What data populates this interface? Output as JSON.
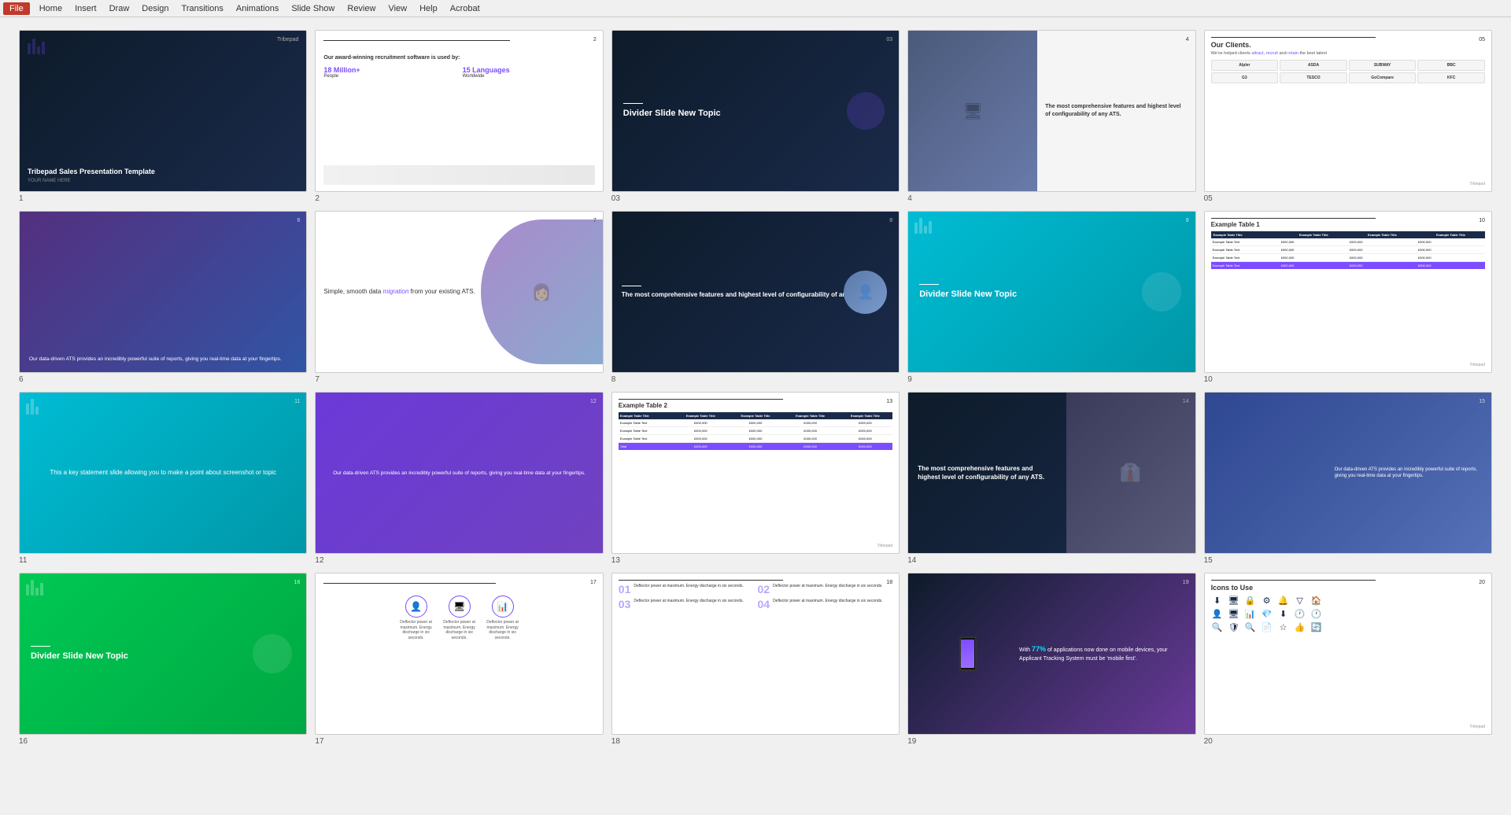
{
  "app": {
    "title": "Tribepad Sales Presentation Template",
    "menu_items": [
      "File",
      "Home",
      "Insert",
      "Draw",
      "Design",
      "Transitions",
      "Animations",
      "Slide Show",
      "Review",
      "View",
      "Help",
      "Acrobat"
    ]
  },
  "slides": [
    {
      "number": "1",
      "type": "title",
      "title": "Tribepad Sales Presentation Template",
      "subtitle": "YOUR NAME HERE",
      "logo": "Tribepad"
    },
    {
      "number": "2",
      "type": "stats",
      "heading": "Our award-winning recruitment software is used by:",
      "stat1_num": "18 Million+",
      "stat1_label": "People",
      "stat2_num": "15 Languages",
      "stat2_label": "Worldwide"
    },
    {
      "number": "03",
      "type": "divider",
      "title": "Divider Slide New Topic"
    },
    {
      "number": "4",
      "type": "photo-text",
      "text": "The most comprehensive features and highest level of configurability of any ATS."
    },
    {
      "number": "05",
      "type": "clients",
      "heading": "Our Clients.",
      "tagline": "We've helped clients attract, recruit and retain the best talent",
      "logos": [
        "Alpler",
        "ASDA",
        "SUBWAY",
        "BBC",
        "G3",
        "TESCO",
        "GoCompare",
        "KFC"
      ]
    },
    {
      "number": "6",
      "type": "photo-overlay",
      "text": "Our data-driven ATS provides an incredibly powerful suite of reports, giving you real-time data at your fingertips."
    },
    {
      "number": "7",
      "type": "migration",
      "text_left": "Simple, smooth data migration from your existing ATS."
    },
    {
      "number": "8",
      "type": "dark-text",
      "text": "The most comprehensive features and highest level of configurability of any ATS."
    },
    {
      "number": "9",
      "type": "divider-cyan",
      "title": "Divider Slide New Topic"
    },
    {
      "number": "10",
      "type": "table",
      "heading": "Example Table 1"
    },
    {
      "number": "11",
      "type": "statement-cyan",
      "text": "This a key statement slide allowing you to make a point about screenshot or topic"
    },
    {
      "number": "12",
      "type": "photo-purple",
      "text": "Our data-driven ATS provides an incredibly powerful suite of reports, giving you real-time data at your fingertips."
    },
    {
      "number": "13",
      "type": "table2",
      "heading": "Example Table 2"
    },
    {
      "number": "14",
      "type": "dark-photo",
      "text": "The most comprehensive features and highest level of configurability of any ATS."
    },
    {
      "number": "15",
      "type": "photo-blue",
      "text": "Our data-driven ATS provides an incredibly powerful suite of reports, giving you real-time data at your fingertips."
    },
    {
      "number": "16",
      "type": "divider-green",
      "title": "Divider Slide New Topic"
    },
    {
      "number": "17",
      "type": "icons",
      "icons": [
        {
          "symbol": "👤",
          "label": "Deflector power at maximum. Energy discharge in six seconds."
        },
        {
          "symbol": "🖥",
          "label": "Deflector power at maximum. Energy discharge in six seconds."
        },
        {
          "symbol": "📊",
          "label": "Deflector power at maximum. Energy discharge in six seconds."
        }
      ]
    },
    {
      "number": "18",
      "type": "features-grid",
      "features": [
        {
          "num": "01",
          "text": "Deflector power at maximum. Energy discharge in six seconds."
        },
        {
          "num": "02",
          "text": "Deflector power at maximum. Energy discharge in six seconds."
        },
        {
          "num": "03",
          "text": "Deflector power at maximum. Energy discharge in six seconds."
        },
        {
          "num": "04",
          "text": "Deflector power at maximum. Energy discharge in six seconds."
        }
      ]
    },
    {
      "number": "19",
      "type": "mobile",
      "stat": "77%",
      "text": "of applications now done on mobile devices, your Applicant Tracking System must be 'mobile first'."
    },
    {
      "number": "20",
      "type": "icons-list",
      "heading": "Icons to Use",
      "icons_row1": [
        "⬇",
        "🖥",
        "🔒",
        "⚙",
        "🔔",
        "🔷",
        "🏠"
      ],
      "icons_row2": [
        "👤",
        "🖥",
        "📊",
        "💎",
        "⬇",
        "🕐",
        "🕐"
      ],
      "icons_row3": [
        "🔍",
        "🛡",
        "🔍",
        "📄",
        "☆",
        "👍",
        "🔄"
      ]
    }
  ]
}
